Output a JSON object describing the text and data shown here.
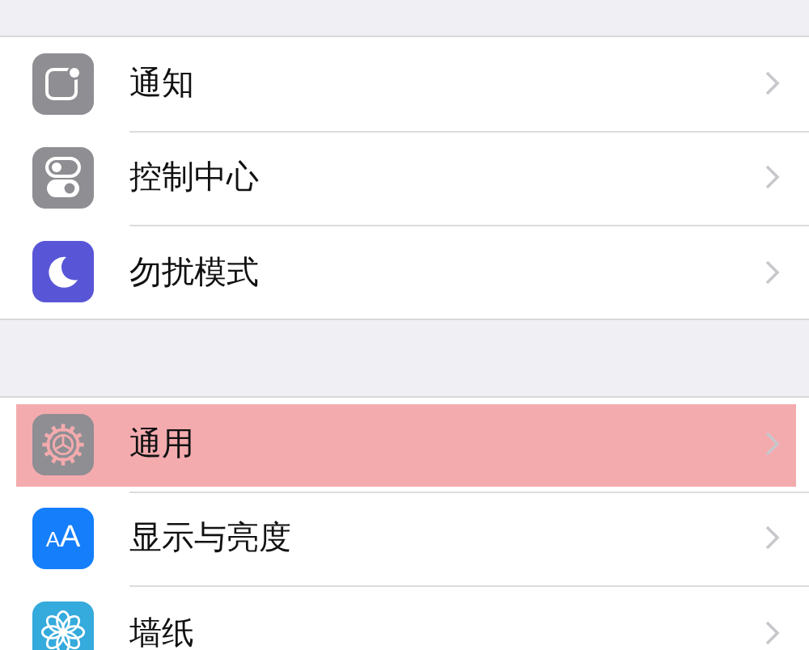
{
  "groups": [
    {
      "rows": [
        {
          "kind": "notifications",
          "label": "通知",
          "selected": false
        },
        {
          "kind": "control-center",
          "label": "控制中心",
          "selected": false
        },
        {
          "kind": "do-not-disturb",
          "label": "勿扰模式",
          "selected": false
        }
      ]
    },
    {
      "rows": [
        {
          "kind": "general",
          "label": "通用",
          "selected": true
        },
        {
          "kind": "display",
          "label": "显示与亮度",
          "icon_text": "AA",
          "selected": false
        },
        {
          "kind": "wallpaper",
          "label": "墙纸",
          "selected": false
        }
      ]
    }
  ]
}
